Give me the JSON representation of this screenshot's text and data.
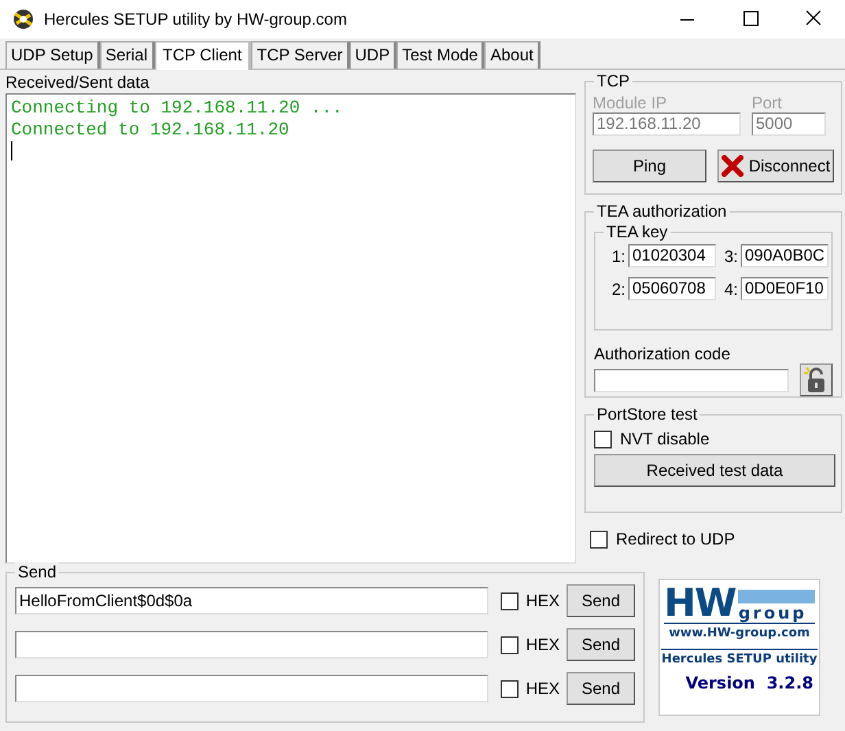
{
  "window": {
    "title": "Hercules SETUP utility by HW-group.com"
  },
  "tabs": [
    {
      "label": "UDP Setup",
      "selected": false
    },
    {
      "label": "Serial",
      "selected": false
    },
    {
      "label": "TCP Client",
      "selected": true
    },
    {
      "label": "TCP Server",
      "selected": false
    },
    {
      "label": "UDP",
      "selected": false
    },
    {
      "label": "Test Mode",
      "selected": false
    },
    {
      "label": "About",
      "selected": false
    }
  ],
  "received": {
    "label": "Received/Sent data",
    "lines": [
      "Connecting to 192.168.11.20 ...",
      "Connected to 192.168.11.20"
    ]
  },
  "tcp": {
    "title": "TCP",
    "disabled": true,
    "module_ip_label": "Module IP",
    "module_ip": "192.168.11.20",
    "port_label": "Port",
    "port": "5000",
    "ping_button": "Ping",
    "disconnect_button": "Disconnect"
  },
  "tea": {
    "title": "TEA authorization",
    "key_title": "TEA key",
    "keys": [
      {
        "label": "1:",
        "value": "01020304"
      },
      {
        "label": "3:",
        "value": "090A0B0C"
      },
      {
        "label": "2:",
        "value": "05060708"
      },
      {
        "label": "4:",
        "value": "0D0E0F10"
      }
    ],
    "auth_label": "Authorization code"
  },
  "portstore": {
    "title": "PortStore test",
    "nvt_label": "NVT disable",
    "nvt_checked": false,
    "test_button": "Received test data"
  },
  "redirect": {
    "label": "Redirect to UDP",
    "checked": false
  },
  "send": {
    "title": "Send",
    "rows": [
      {
        "value": "HelloFromClient$0d$0a",
        "hex_label": "HEX",
        "hex_checked": false,
        "button": "Send"
      },
      {
        "hex_label": "HEX",
        "hex_checked": false,
        "button": "Send"
      },
      {
        "hex_label": "HEX",
        "hex_checked": false,
        "button": "Send"
      }
    ]
  },
  "logo": {
    "mark": "HW",
    "group": "group",
    "url": "www.HW-group.com",
    "product": "Hercules SETUP utility",
    "version": "Version  3.2.8"
  }
}
